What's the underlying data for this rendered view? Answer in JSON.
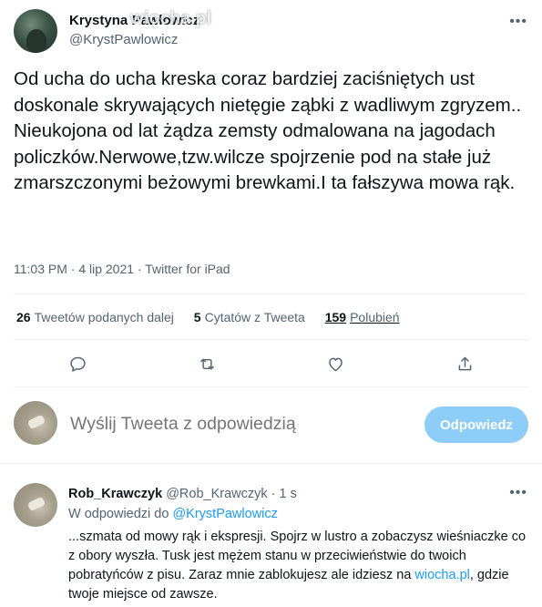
{
  "tweet": {
    "author_name": "Krystyna Pawłowicz",
    "author_handle": "@KrystPawlowicz",
    "watermark": "wiocha.pl",
    "more_icon": "more-dots-icon",
    "paragraphs": [
      "Od ucha do ucha kreska coraz bardziej zaciśniętych ust doskonale skrywających nietęgie ząbki z wadliwym zgryzem..",
      "Nieukojona od lat żądza zemsty odmalowana na jagodach policzków.Nerwowe,tzw.wilcze spojrzenie pod na stałe już zmarszczonymi beżowymi brewkami.I ta fałszywa mowa rąk."
    ],
    "timestamp": "11:03 PM · 4 lip 2021 · Twitter for iPad"
  },
  "stats": {
    "retweets_count": "26",
    "retweets_label": "Tweetów podanych dalej",
    "quotes_count": "5",
    "quotes_label": "Cytatów z Tweeta",
    "likes_count": "159",
    "likes_label": "Polubień"
  },
  "actions": [
    "reply-icon",
    "retweet-icon",
    "like-icon",
    "share-icon"
  ],
  "reply_compose": {
    "placeholder": "Wyślij Tweeta z odpowiedzią",
    "button_label": "Odpowiedz"
  },
  "reply": {
    "name": "Rob_Krawczyk",
    "handle": "@Rob_Krawczyk",
    "dot": "·",
    "time": "1 s",
    "replying_prefix": "W odpowiedzi do",
    "replying_handle": "@KrystPawlowicz",
    "body_part1": "...szmata od mowy rąk i ekspresji. Spojrz w lustro a zobaczysz wieśniaczke co z obory wyszła. Tusk jest mężem stanu w przeciwieństwie do twoich pobratyńców z pisu. Zaraz mnie zablokujesz ale idziesz na",
    "body_link": "wiocha.pl",
    "body_part2": ", gdzie twoje miejsce od zawsze."
  },
  "colors": {
    "accent": "#1d9bf0",
    "button_disabled": "#8ecdf8",
    "secondary_text": "#536471",
    "divider": "#eff3f4"
  }
}
